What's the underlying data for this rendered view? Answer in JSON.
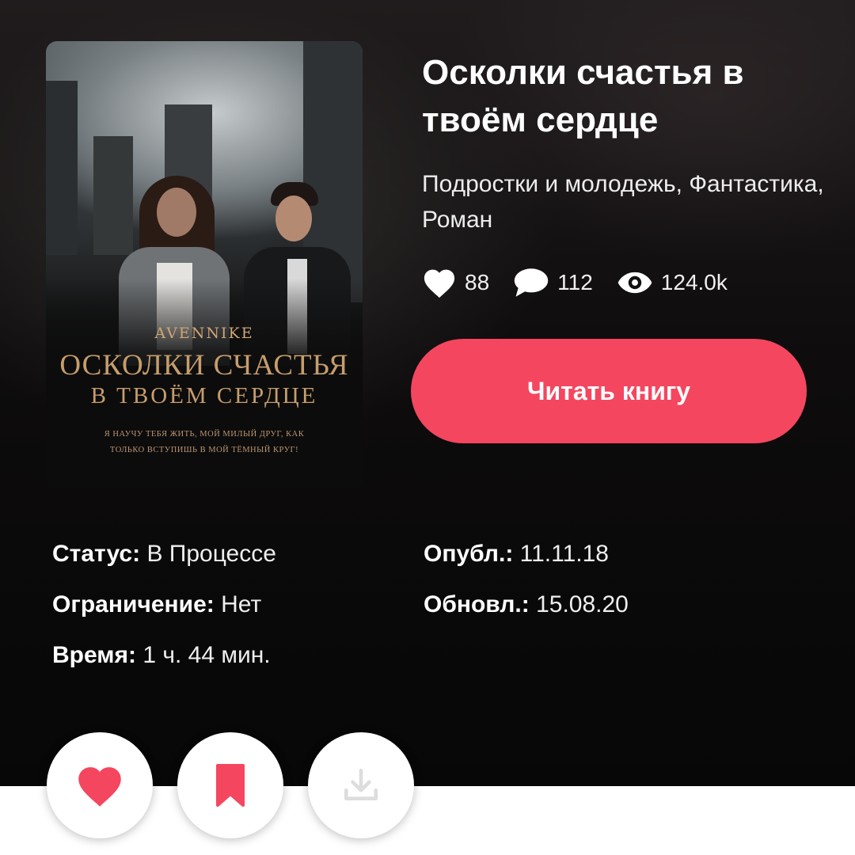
{
  "book": {
    "title": "Осколки счастья в твоём сердце",
    "genres": "Подростки и молодежь, Фантастика, Роман",
    "cover": {
      "author": "AVENNIKE",
      "title_line1": "ОСКОЛКИ СЧАСТЬЯ",
      "title_line2": "В ТВОЁМ СЕРДЦЕ",
      "tagline_line1": "Я НАУЧУ ТЕБЯ ЖИТЬ, МОЙ МИЛЫЙ ДРУГ, КАК",
      "tagline_line2": "ТОЛЬКО ВСТУПИШЬ В МОЙ ТЁМНЫЙ КРУГ!"
    }
  },
  "stats": {
    "likes": "88",
    "comments": "112",
    "views": "124.0k"
  },
  "actions": {
    "read_label": "Читать книгу"
  },
  "meta": {
    "status_label": "Статус:",
    "status_value": "В Процессе",
    "restriction_label": "Ограничение:",
    "restriction_value": "Нет",
    "time_label": "Время:",
    "time_value": "1 ч. 44 мин.",
    "published_label": "Опубл.:",
    "published_value": "11.11.18",
    "updated_label": "Обновл.:",
    "updated_value": "15.08.20"
  },
  "icons": {
    "like": "heart-icon",
    "comment": "speech-bubble-icon",
    "views": "eye-icon",
    "favorite": "heart-icon",
    "bookmark": "bookmark-icon",
    "download": "download-icon"
  },
  "colors": {
    "accent": "#f5465f",
    "background": "#0b0b0d",
    "cover_gold": "#c79d6c",
    "disabled_icon": "#dddddd"
  }
}
